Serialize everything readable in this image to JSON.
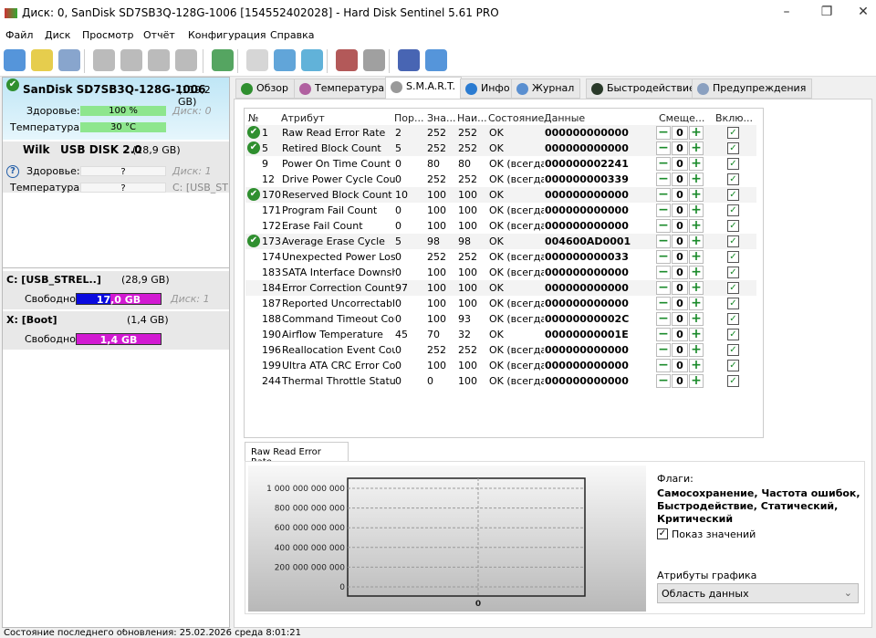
{
  "window": {
    "title": "Диск: 0, SanDisk SD7SB3Q-128G-1006 [154552402028]  -  Hard Disk Sentinel 5.61 PRO"
  },
  "menu": [
    "Файл",
    "Диск",
    "Просмотр",
    "Отчёт",
    "Конфигурация",
    "Справка"
  ],
  "toolbar": [
    "refresh-icon",
    "alert-icon",
    "disk-icon",
    "disk-tool-1-icon",
    "disk-tool-2-icon",
    "disk-check-icon",
    "disk-search-icon",
    "globe-icon",
    "report-icon",
    "sync-icon",
    "network-icon",
    "monitor-icon",
    "speaker-icon",
    "help-icon",
    "info-icon"
  ],
  "disks": [
    {
      "name": "SanDisk SD7SB3Q-128G-1006",
      "size": "(119,2 GB)",
      "health_label": "Здоровье:",
      "health": "100 %",
      "health_pct": 100,
      "temp_label": "Температура:",
      "temp": "30 °C",
      "disk": "Диск: 0",
      "status": "ok"
    },
    {
      "vendor": "Wilk",
      "name": "USB DISK 2.0",
      "size": "(28,9 GB)",
      "health_label": "Здоровье:",
      "health": "?",
      "temp_label": "Температура:",
      "temp": "?",
      "disk": "Диск: 1",
      "volume": "C: [USB_STR",
      "status": "unknown"
    }
  ],
  "volumes": [
    {
      "name": "C: [USB_STREL..]",
      "size": "(28,9 GB)",
      "free_label": "Свободно",
      "free": "17,0 GB",
      "disk": "Диск: 1"
    },
    {
      "name": "X: [Boot]",
      "size": "(1,4 GB)",
      "free_label": "Свободно",
      "free": "1,4 GB"
    }
  ],
  "tabs": [
    "Обзор",
    "Температура",
    "S.M.A.R.T.",
    "Инфо",
    "Журнал",
    "Быстродействие",
    "Предупреждения"
  ],
  "active_tab": "S.M.A.R.T.",
  "smart": {
    "headers": [
      "№",
      "Атрибут",
      "Пор...",
      "Зна...",
      "Наи...",
      "Состояние",
      "Данные",
      "Смеще...",
      "Вклю..."
    ],
    "rows": [
      [
        "1",
        "Raw Read Error Rate",
        "2",
        "252",
        "252",
        "OK",
        "000000000000",
        "0",
        true,
        true
      ],
      [
        "5",
        "Retired Block Count",
        "5",
        "252",
        "252",
        "OK",
        "000000000000",
        "0",
        true,
        true
      ],
      [
        "9",
        "Power On Time Count",
        "0",
        "80",
        "80",
        "OK (всегда...",
        "000000002241",
        "0",
        false,
        true
      ],
      [
        "12",
        "Drive Power Cycle Count",
        "0",
        "252",
        "252",
        "OK (всегда...",
        "000000000339",
        "0",
        false,
        true
      ],
      [
        "170",
        "Reserved Block Count",
        "10",
        "100",
        "100",
        "OK",
        "000000000000",
        "0",
        true,
        true
      ],
      [
        "171",
        "Program Fail Count",
        "0",
        "100",
        "100",
        "OK (всегда...",
        "000000000000",
        "0",
        false,
        true
      ],
      [
        "172",
        "Erase Fail Count",
        "0",
        "100",
        "100",
        "OK (всегда...",
        "000000000000",
        "0",
        false,
        true
      ],
      [
        "173",
        "Average Erase Cycle",
        "5",
        "98",
        "98",
        "OK",
        "004600AD0001",
        "0",
        true,
        true
      ],
      [
        "174",
        "Unexpected Power Loss...",
        "0",
        "252",
        "252",
        "OK (всегда...",
        "000000000033",
        "0",
        false,
        true
      ],
      [
        "183",
        "SATA Interface Downsh...",
        "0",
        "100",
        "100",
        "OK (всегда...",
        "000000000000",
        "0",
        false,
        true
      ],
      [
        "184",
        "Error Correction Count",
        "97",
        "100",
        "100",
        "OK",
        "000000000000",
        "0",
        false,
        true
      ],
      [
        "187",
        "Reported Uncorrectabl...",
        "0",
        "100",
        "100",
        "OK (всегда...",
        "000000000000",
        "0",
        false,
        true
      ],
      [
        "188",
        "Command Timeout Cou...",
        "0",
        "100",
        "93",
        "OK (всегда...",
        "00000000002C",
        "0",
        false,
        true
      ],
      [
        "190",
        "Airflow Temperature",
        "45",
        "70",
        "32",
        "OK",
        "00000000001E",
        "0",
        false,
        true
      ],
      [
        "196",
        "Reallocation Event Count",
        "0",
        "252",
        "252",
        "OK (всегда...",
        "000000000000",
        "0",
        false,
        true
      ],
      [
        "199",
        "Ultra ATA CRC Error Co...",
        "0",
        "100",
        "100",
        "OK (всегда...",
        "000000000000",
        "0",
        false,
        true
      ],
      [
        "244",
        "Thermal Throttle Status",
        "0",
        "0",
        "100",
        "OK (всегда...",
        "000000000000",
        "0",
        false,
        true
      ]
    ]
  },
  "chart_tab": "Raw Read Error Rate",
  "chart_data": {
    "type": "line",
    "title": "",
    "ylim": [
      0,
      1000000000000
    ],
    "yticks": [
      "0",
      "200 000 000 000",
      "400 000 000 000",
      "600 000 000 000",
      "800 000 000 000",
      "1 000 000 000 000"
    ],
    "xticks": [
      "0"
    ],
    "series": [],
    "grid": true
  },
  "flags": {
    "label": "Флаги:",
    "value": "Самосохранение, Частота ошибок, Быстродействие, Статический, Критический",
    "show_values": "Показ значений",
    "show_values_checked": true,
    "graph_attr_label": "Атрибуты графика",
    "graph_attr_value": "Область данных"
  },
  "status": "Состояние последнего обновления: 25.02.2026 среда 8:01:21"
}
